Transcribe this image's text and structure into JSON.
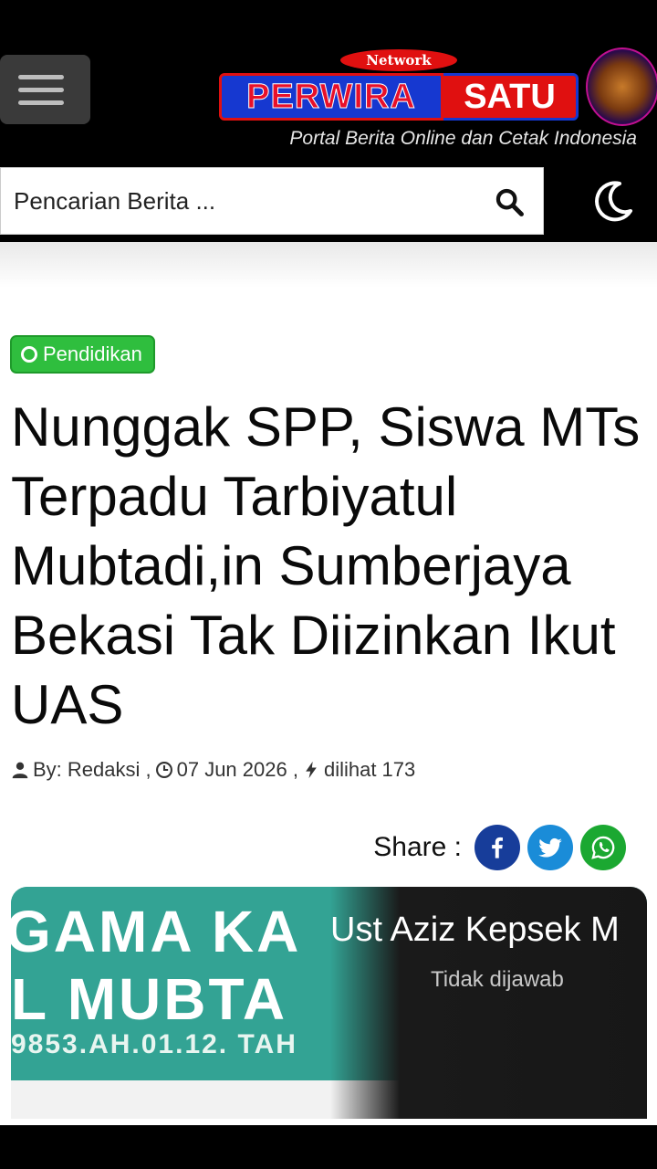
{
  "header": {
    "network_label": "Network",
    "brand_left": "PERWIRA",
    "brand_right": "SATU",
    "tagline": "Portal Berita Online dan Cetak Indonesia",
    "emblem_text": "PERWIRA SATU"
  },
  "search": {
    "placeholder": "Pencarian Berita ..."
  },
  "article": {
    "category": "Pendidikan",
    "title": "Nunggak SPP, Siswa MTs Terpadu Tarbiyatul Mubtadi,in Sumberjaya Bekasi Tak Diizinkan Ikut UAS",
    "author": "By: Redaksi ,",
    "date": "07 Jun 2026 ,",
    "views": "dilihat 173"
  },
  "share": {
    "label": "Share :"
  },
  "image": {
    "sign_line1": "GAMA KA",
    "sign_line2": "L MUBTA",
    "sign_line3": "9853.AH.01.12. TAH",
    "caller_name": "Ust Aziz Kepsek M",
    "call_status": "Tidak dijawab"
  },
  "colors": {
    "category_green": "#2fbe3e",
    "facebook": "#173d9a",
    "twitter": "#1a8cd8",
    "whatsapp": "#1ba831"
  }
}
